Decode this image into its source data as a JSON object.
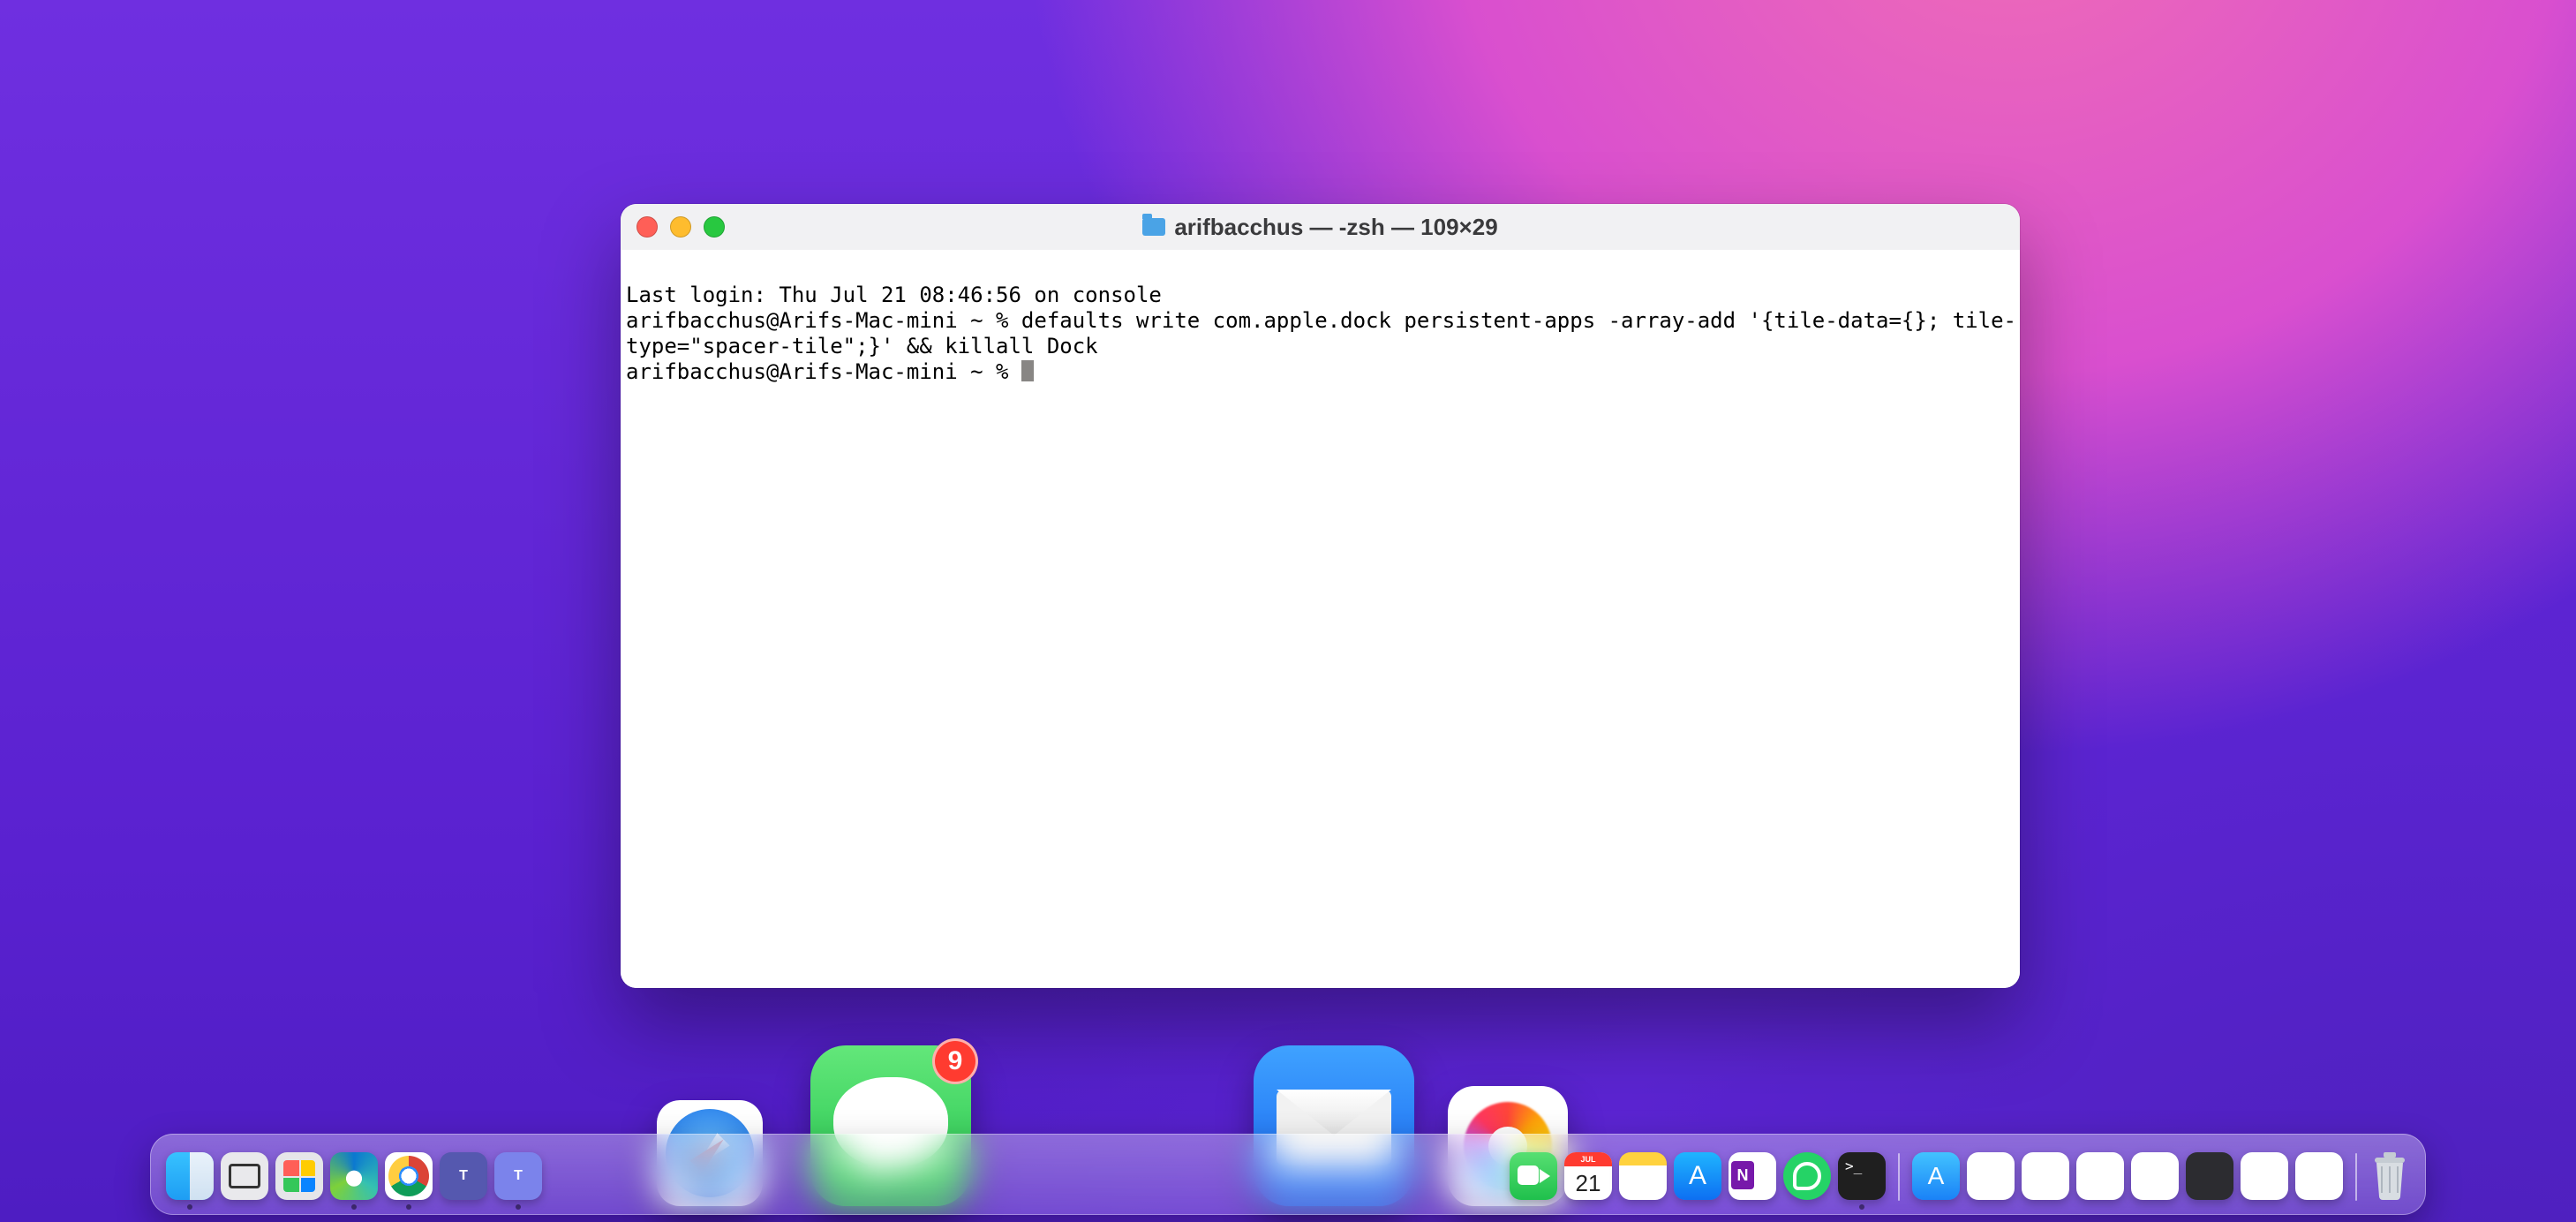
{
  "terminal": {
    "title": "arifbacchus — -zsh — 109×29",
    "lines": [
      "Last login: Thu Jul 21 08:46:56 on console",
      "arifbacchus@Arifs-Mac-mini ~ % defaults write com.apple.dock persistent-apps -array-add '{tile-data={}; tile-",
      "type=\"spacer-tile\";}' && killall Dock",
      "arifbacchus@Arifs-Mac-mini ~ % "
    ],
    "cursor_after_line": 3
  },
  "dock": {
    "left_items": [
      {
        "name": "finder",
        "label": "Finder",
        "running": true
      },
      {
        "name": "screenshot",
        "label": "Screenshot",
        "running": false
      },
      {
        "name": "launchpad",
        "label": "Launchpad",
        "running": false
      },
      {
        "name": "edge",
        "label": "Microsoft Edge",
        "running": true
      },
      {
        "name": "chrome",
        "label": "Google Chrome",
        "running": true
      },
      {
        "name": "teams1",
        "label": "Microsoft Teams",
        "letter": "T",
        "running": false
      },
      {
        "name": "teams2",
        "label": "Microsoft Teams (work)",
        "letter": "T",
        "running": true
      }
    ],
    "magnified": [
      {
        "name": "safari",
        "label": "Safari",
        "badge": null,
        "running": false
      },
      {
        "name": "messages",
        "label": "Messages",
        "badge": "9",
        "running": false
      },
      {
        "name": "spacer",
        "label": "",
        "badge": null,
        "running": false
      },
      {
        "name": "mail",
        "label": "Mail",
        "badge": null,
        "running": false
      },
      {
        "name": "photos",
        "label": "Photos",
        "badge": null,
        "running": false
      }
    ],
    "right_items": [
      {
        "name": "facetime",
        "label": "FaceTime",
        "running": false
      },
      {
        "name": "calendar",
        "label": "Calendar",
        "month": "JUL",
        "day": "21",
        "running": false
      },
      {
        "name": "notes",
        "label": "Notes",
        "running": false
      },
      {
        "name": "appstore",
        "label": "App Store",
        "running": false
      },
      {
        "name": "onenote",
        "label": "OneNote",
        "running": false
      },
      {
        "name": "whatsapp",
        "label": "WhatsApp",
        "running": false
      },
      {
        "name": "terminal",
        "label": "Terminal",
        "running": true
      }
    ],
    "after_separator": [
      {
        "name": "appstore2",
        "label": "App Store (recent)"
      },
      {
        "name": "recent-1",
        "label": "Recent app"
      },
      {
        "name": "recent-2",
        "label": "Recent app"
      },
      {
        "name": "recent-3",
        "label": "Recent app"
      },
      {
        "name": "recent-4",
        "label": "Recent app"
      },
      {
        "name": "recent-5",
        "label": "Recent app"
      },
      {
        "name": "recent-6",
        "label": "Recent app"
      },
      {
        "name": "recent-7",
        "label": "Recent app"
      }
    ],
    "trash_label": "Trash"
  }
}
